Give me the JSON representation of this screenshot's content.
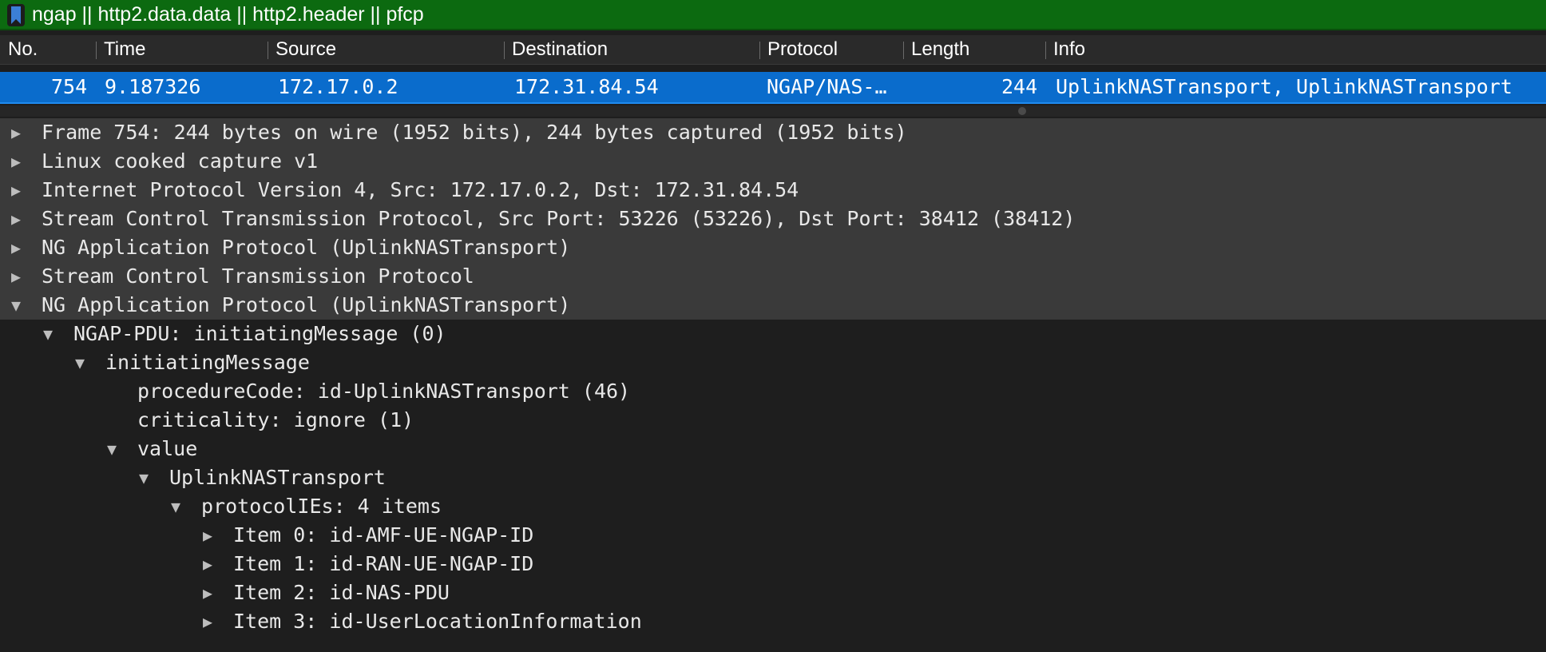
{
  "filter": {
    "value": "ngap || http2.data.data || http2.header || pfcp",
    "bookmark_icon": "bookmark-icon"
  },
  "columns": [
    "No.",
    "Time",
    "Source",
    "Destination",
    "Protocol",
    "Length",
    "Info"
  ],
  "packet": {
    "no": "754",
    "time": "9.187326",
    "source": "172.17.0.2",
    "destination": "172.31.84.54",
    "protocol": "NGAP/NAS-…",
    "length": "244",
    "info": "UplinkNASTransport, UplinkNASTransport"
  },
  "tree": [
    {
      "label": "Frame 754: 244 bytes on wire (1952 bits), 244 bytes captured (1952 bits)",
      "expanded": false,
      "depth": 0
    },
    {
      "label": "Linux cooked capture v1",
      "expanded": false,
      "depth": 0
    },
    {
      "label": "Internet Protocol Version 4, Src: 172.17.0.2, Dst: 172.31.84.54",
      "expanded": false,
      "depth": 0
    },
    {
      "label": "Stream Control Transmission Protocol, Src Port: 53226 (53226), Dst Port: 38412 (38412)",
      "expanded": false,
      "depth": 0
    },
    {
      "label": "NG Application Protocol (UplinkNASTransport)",
      "expanded": false,
      "depth": 0
    },
    {
      "label": "Stream Control Transmission Protocol",
      "expanded": false,
      "depth": 0
    },
    {
      "label": "NG Application Protocol (UplinkNASTransport)",
      "expanded": true,
      "depth": 0
    },
    {
      "label": "NGAP-PDU: initiatingMessage (0)",
      "expanded": true,
      "depth": 1
    },
    {
      "label": "initiatingMessage",
      "expanded": true,
      "depth": 2
    },
    {
      "label": "procedureCode: id-UplinkNASTransport (46)",
      "expanded": null,
      "depth": 3
    },
    {
      "label": "criticality: ignore (1)",
      "expanded": null,
      "depth": 3
    },
    {
      "label": "value",
      "expanded": true,
      "depth": 3
    },
    {
      "label": "UplinkNASTransport",
      "expanded": true,
      "depth": 4
    },
    {
      "label": "protocolIEs: 4 items",
      "expanded": true,
      "depth": 5
    },
    {
      "label": "Item 0: id-AMF-UE-NGAP-ID",
      "expanded": false,
      "depth": 6
    },
    {
      "label": "Item 1: id-RAN-UE-NGAP-ID",
      "expanded": false,
      "depth": 6
    },
    {
      "label": "Item 2: id-NAS-PDU",
      "expanded": false,
      "depth": 6
    },
    {
      "label": "Item 3: id-UserLocationInformation",
      "expanded": false,
      "depth": 6
    }
  ],
  "colors": {
    "filter_bg": "#0c6a10",
    "selected_row": "#0a6ccc",
    "tree_top_bg": "#3a3a3a",
    "pane_bg": "#1e1e1e"
  }
}
